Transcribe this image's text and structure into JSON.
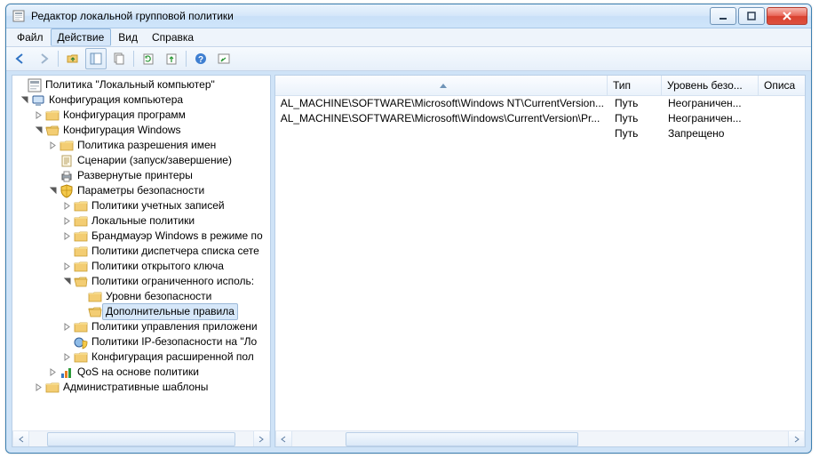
{
  "window": {
    "title": "Редактор локальной групповой политики"
  },
  "menu": {
    "file": "Файл",
    "action": "Действие",
    "view": "Вид",
    "help": "Справка"
  },
  "tree": {
    "root": "Политика \"Локальный компьютер\"",
    "compConfig": "Конфигурация компьютера",
    "progConfig": "Конфигурация программ",
    "winConfig": "Конфигурация Windows",
    "nameResPolicy": "Политика разрешения имен",
    "scripts": "Сценарии (запуск/завершение)",
    "deployedPrinters": "Развернутые принтеры",
    "securitySettings": "Параметры безопасности",
    "accountPolicies": "Политики учетных записей",
    "localPolicies": "Локальные политики",
    "winFirewall": "Брандмауэр Windows в режиме по",
    "nlmPolicies": "Политики диспетчера списка сете",
    "pkPolicies": "Политики открытого ключа",
    "srp": "Политики ограниченного исполь:",
    "secLevels": "Уровни безопасности",
    "addRules": "Дополнительные правила",
    "appControl": "Политики управления приложени",
    "ipsec": "Политики IP-безопасности на \"Ло",
    "advAudit": "Конфигурация расширенной пол",
    "qos": "QoS на основе политики",
    "adminTemplates": "Административные шаблоны"
  },
  "columns": {
    "type": "Тип",
    "secLevel": "Уровень безо...",
    "desc": "Описа"
  },
  "rows": [
    {
      "name": "AL_MACHINE\\SOFTWARE\\Microsoft\\Windows NT\\CurrentVersion...",
      "type": "Путь",
      "level": "Неограничен..."
    },
    {
      "name": "AL_MACHINE\\SOFTWARE\\Microsoft\\Windows\\CurrentVersion\\Pr...",
      "type": "Путь",
      "level": "Неограничен..."
    },
    {
      "name": "",
      "type": "Путь",
      "level": "Запрещено"
    }
  ],
  "colors": {
    "folder": "#f3cd73",
    "folderShade": "#d9a838"
  }
}
